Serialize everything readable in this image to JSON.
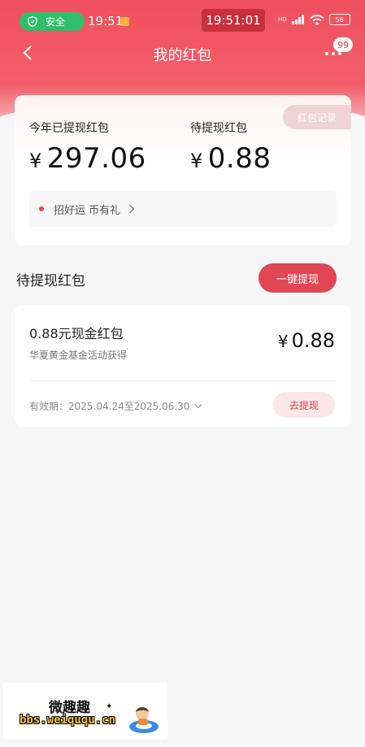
{
  "status_bar": {
    "safe_label": "安全",
    "time_small": "19:51",
    "time_big": "19:51:01",
    "network": "HD",
    "battery": "56"
  },
  "nav": {
    "title": "我的红包",
    "badge_count": "99"
  },
  "summary": {
    "record_button": "红包记录",
    "withdrawn_label": "今年已提现红包",
    "withdrawn_currency": "¥",
    "withdrawn_amount": "297.06",
    "pending_label": "待提现红包",
    "pending_currency": "¥",
    "pending_amount": "0.88",
    "promo_text": "招好运 币有礼"
  },
  "pending_section": {
    "title": "待提现红包",
    "one_click_button": "一键提现"
  },
  "items": [
    {
      "name": "0.88元现金红包",
      "source": "华夏黄金基金活动获得",
      "currency": "¥",
      "amount": "0.88",
      "validity": "有效期：2025.04.24至2025.06.30",
      "action": "去提现"
    }
  ],
  "watermark": {
    "name": "微趣趣",
    "url": "bbs.weiququ.cn"
  },
  "colors": {
    "brand_red": "#ef4f5d",
    "button_red": "#e04653",
    "safe_green": "#2fbf6c"
  }
}
